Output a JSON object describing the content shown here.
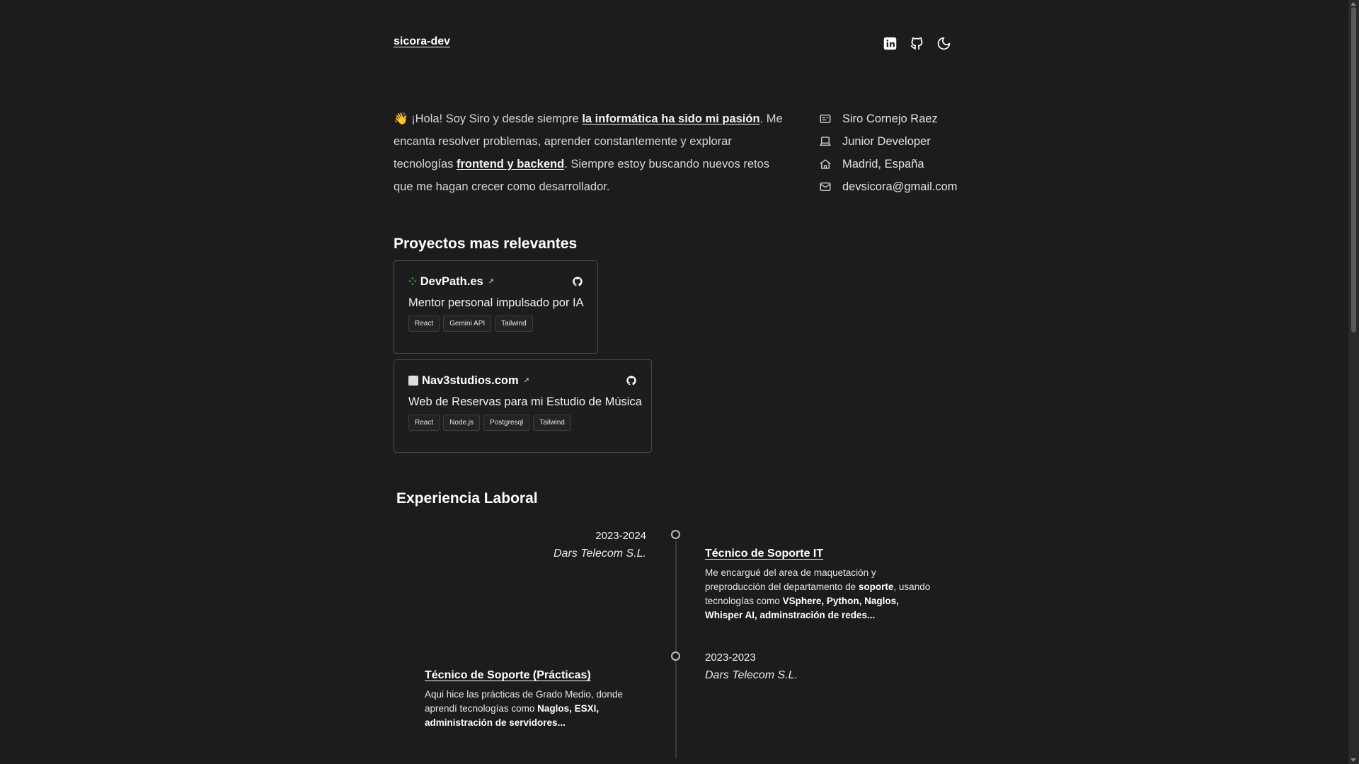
{
  "header": {
    "site_name": "sicora-dev",
    "icons": [
      "linkedin-icon",
      "github-icon",
      "moon-icon"
    ]
  },
  "intro": {
    "emoji": "👋",
    "part1": " ¡Hola! Soy Siro y desde siempre ",
    "link1": "la informática ha sido mi pasión",
    "part2": ". Me encanta resolver problemas, aprender constantemente y explorar tecnologías ",
    "link2": "frontend y backend",
    "part3": ". Siempre estoy buscando nuevos retos que me hagan crecer como desarrollador."
  },
  "info": {
    "name": "Siro Cornejo Raez",
    "role": "Junior Developer",
    "location": "Madrid, España",
    "email": "devsicora@gmail.com"
  },
  "projects": {
    "title": "Proyectos mas relevantes",
    "items": [
      {
        "name": "DevPath.es",
        "description": "Mentor personal impulsado por IA",
        "tags": [
          "React",
          "Gemini API",
          "Tailwind"
        ]
      },
      {
        "name": "Nav3studios.com",
        "description": "Web de Reservas para mi Estudio de Música",
        "tags": [
          "React",
          "Node.js",
          "Postgresql",
          "Tailwind"
        ]
      }
    ]
  },
  "experience": {
    "title": "Experiencia Laboral",
    "items": [
      {
        "date": "2023-2024",
        "company": "Dars Telecom S.L.",
        "role": "Técnico de Soporte IT",
        "text_a": "Me encargué del area de maquetación y preproducción del departamento de ",
        "text_b": "soporte",
        "text_c": ", usando tecnologías como ",
        "text_d": "VSphere, Python, Naglos, Whisper AI, adminstración de redes..."
      },
      {
        "date": "2023-2023",
        "company": "Dars Telecom S.L.",
        "role": "Técnico de Soporte (Prácticas)",
        "text_a": "Aqui hice las prácticas de Grado Medio, donde aprendí tecnologías como ",
        "text_b": "Naglos, ESXI, administración de servidores..."
      }
    ]
  }
}
